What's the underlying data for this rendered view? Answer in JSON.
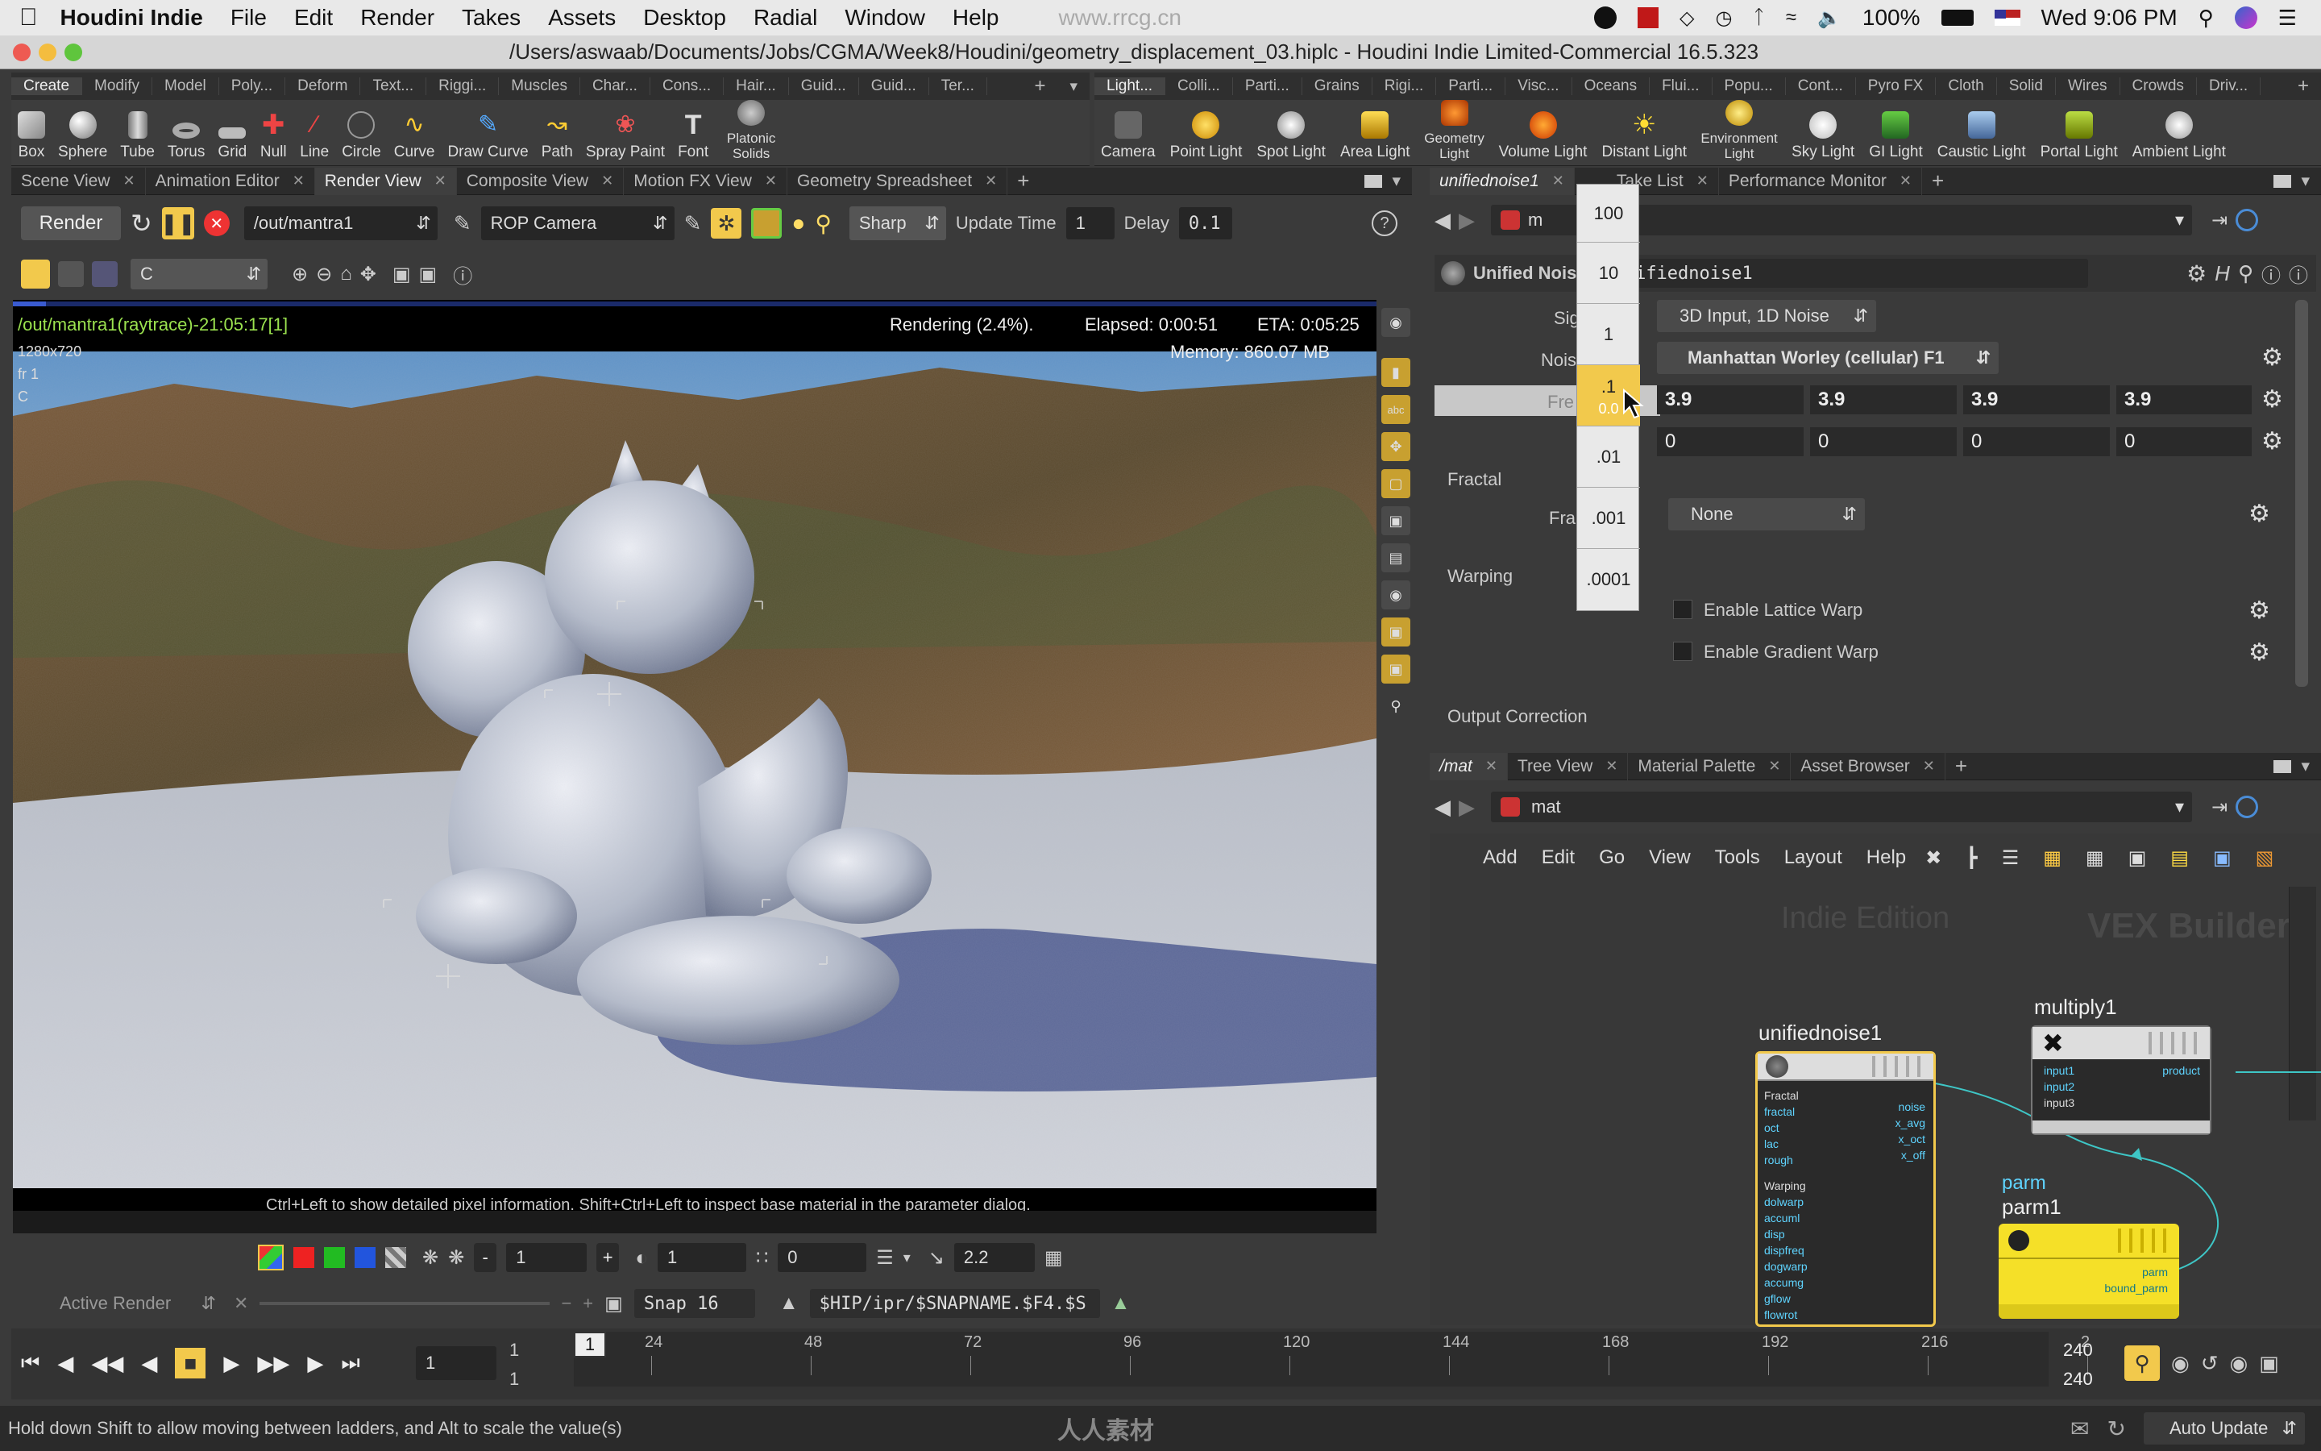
{
  "menubar": {
    "app": "Houdini Indie",
    "items": [
      "File",
      "Edit",
      "Render",
      "Takes",
      "Assets",
      "Desktop",
      "Radial",
      "Window",
      "Help"
    ],
    "watermark": "www.rrcg.cn",
    "battery": "100%",
    "flag": "US",
    "clock": "Wed 9:06 PM"
  },
  "window": {
    "title": "/Users/aswaab/Documents/Jobs/CGMA/Week8/Houdini/geometry_displacement_03.hiplc - Houdini Indie Limited-Commercial 16.5.323"
  },
  "shelf_left": {
    "tabs": [
      "Create",
      "Modify",
      "Model",
      "Poly...",
      "Deform",
      "Text...",
      "Riggi...",
      "Muscles",
      "Char...",
      "Cons...",
      "Hair...",
      "Guid...",
      "Guid...",
      "Ter..."
    ],
    "tools": [
      "Box",
      "Sphere",
      "Tube",
      "Torus",
      "Grid",
      "Null",
      "Line",
      "Circle",
      "Curve",
      "Draw Curve",
      "Path",
      "Spray Paint",
      "Font",
      "Platonic Solids"
    ]
  },
  "shelf_right": {
    "tabs": [
      "Light...",
      "Colli...",
      "Parti...",
      "Grains",
      "Rigi...",
      "Parti...",
      "Visc...",
      "Oceans",
      "Flui...",
      "Popu...",
      "Cont...",
      "Pyro FX",
      "Cloth",
      "Solid",
      "Wires",
      "Crowds",
      "Driv..."
    ],
    "tools": [
      "Camera",
      "Point Light",
      "Spot Light",
      "Area Light",
      "Geometry Light",
      "Volume Light",
      "Distant Light",
      "Environment Light",
      "Sky Light",
      "GI Light",
      "Caustic Light",
      "Portal Light",
      "Ambient Light"
    ]
  },
  "left_tabs": [
    "Scene View",
    "Animation Editor",
    "Render View",
    "Composite View",
    "Motion FX View",
    "Geometry Spreadsheet"
  ],
  "render_toolbar": {
    "render_label": "Render",
    "rop_path": "/out/mantra1",
    "camera": "ROP Camera",
    "filter": "Sharp",
    "update_time_label": "Update Time",
    "update_time": "1",
    "delay_label": "Delay",
    "delay": "0.1",
    "channel": "C"
  },
  "render_view": {
    "name": "/out/mantra1(raytrace)-21:05:17[1]",
    "status": "Rendering (2.4%).",
    "elapsed": "Elapsed: 0:00:51",
    "eta": "ETA: 0:05:25",
    "memory": "Memory:   860.07 MB",
    "res": "1280x720",
    "frame": "fr 1",
    "chan": "C",
    "hint": "Ctrl+Left to show detailed pixel information. Shift+Ctrl+Left to inspect base material in the parameter dialog.",
    "progress": 0.024
  },
  "view_controls": {
    "minus": "-",
    "val1": "1",
    "plus": "+",
    "val2": "1",
    "val3": "0",
    "gamma": "2.2"
  },
  "active_render": {
    "label": "Active Render",
    "snap": "Snap 16",
    "path": "$HIP/ipr/$SNAPNAME.$F4.$S"
  },
  "timeline": {
    "frame": "1",
    "start": "1",
    "start2": "1",
    "end": "240",
    "end2": "240",
    "ticks": [
      "24",
      "48",
      "72",
      "96",
      "120",
      "144",
      "168",
      "192",
      "216",
      "2"
    ],
    "current": "1"
  },
  "status": {
    "message": "Hold down Shift to allow moving between ladders, and Alt to scale the value(s)",
    "watermark": "人人素材",
    "auto_update": "Auto Update"
  },
  "right_tabs": [
    "unifiednoise1",
    "Take List",
    "Performance Monitor"
  ],
  "params": {
    "node_path": "m",
    "node_type": "Unified Noise",
    "node_name": "unifiednoise1",
    "sig_label": "Sig",
    "sig_value": "3D Input, 1D Noise",
    "noise_label": "Nois",
    "noise_value": "Manhattan Worley (cellular) F1",
    "freq_label": "Fre",
    "freq": [
      "3.9",
      "3.9",
      "3.9",
      "3.9"
    ],
    "offset": [
      "0",
      "0",
      "0",
      "0"
    ],
    "fractal_label": "Fractal",
    "fractal_type_label": "Fra",
    "fractal_type_suffix": "e",
    "fractal_type": "None",
    "warping_label": "Warping",
    "lattice": "Enable Lattice Warp",
    "gradient": "Enable Gradient Warp",
    "output_label": "Output Correction"
  },
  "ladder": {
    "values": [
      "100",
      "10",
      "1",
      ".1",
      "0.0",
      ".01",
      ".001",
      ".0001"
    ]
  },
  "network_tabs": [
    "/mat",
    "Tree View",
    "Material Palette",
    "Asset Browser"
  ],
  "network": {
    "path": "mat",
    "menu": [
      "Add",
      "Edit",
      "Go",
      "View",
      "Tools",
      "Layout",
      "Help"
    ],
    "indie": "Indie Edition",
    "vex": "VEX Builder",
    "node1": {
      "name": "unifiednoise1",
      "inputs": [
        "Fractal",
        "fractal",
        "oct",
        "lac",
        "rough",
        "Warping",
        "dolwarp",
        "accuml",
        "disp",
        "dispfreq",
        "dogwarp",
        "accumg",
        "gflow",
        "flowrot"
      ],
      "outputs": [
        "noise",
        "x_avg",
        "x_oct",
        "x_off"
      ]
    },
    "node2": {
      "name": "multiply1",
      "inputs": [
        "input1",
        "input2",
        "input3"
      ],
      "output": "product"
    },
    "node3": {
      "category": "parm",
      "name": "parm1",
      "outputs": [
        "parm",
        "bound_parm"
      ]
    }
  },
  "colors": {
    "accent": "#f2c94c",
    "node_yellow": "#f5e028",
    "wire": "#3ec6c6",
    "render_text": "#9be24f"
  }
}
